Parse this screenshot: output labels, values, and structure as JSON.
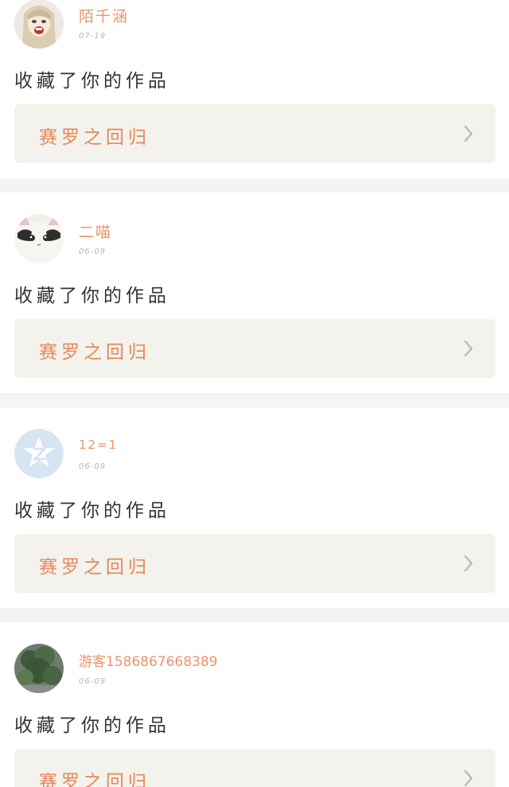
{
  "notifications": [
    {
      "username": "陌千涵",
      "date": "07-19",
      "action": "收藏了你的作品",
      "work_title": "赛罗之回归",
      "avatar_icon": "anime-girl-avatar-icon"
    },
    {
      "username": "二喵",
      "date": "06-09",
      "action": "收藏了你的作品",
      "work_title": "赛罗之回归",
      "avatar_icon": "cat-avatar-icon"
    },
    {
      "username": "12=1",
      "date": "06-09",
      "action": "收藏了你的作品",
      "work_title": "赛罗之回归",
      "avatar_icon": "default-qq-avatar-icon"
    },
    {
      "username": "游客15868676683​89",
      "date": "06-09",
      "action": "收藏了你的作品",
      "work_title": "赛罗之回归",
      "avatar_icon": "plant-avatar-icon"
    }
  ],
  "colors": {
    "accent": "#e6885a",
    "username": "#e9956a",
    "card_bg": "#ffffff",
    "link_bg": "#f3f2ec",
    "page_bg": "#f4f4f4"
  }
}
